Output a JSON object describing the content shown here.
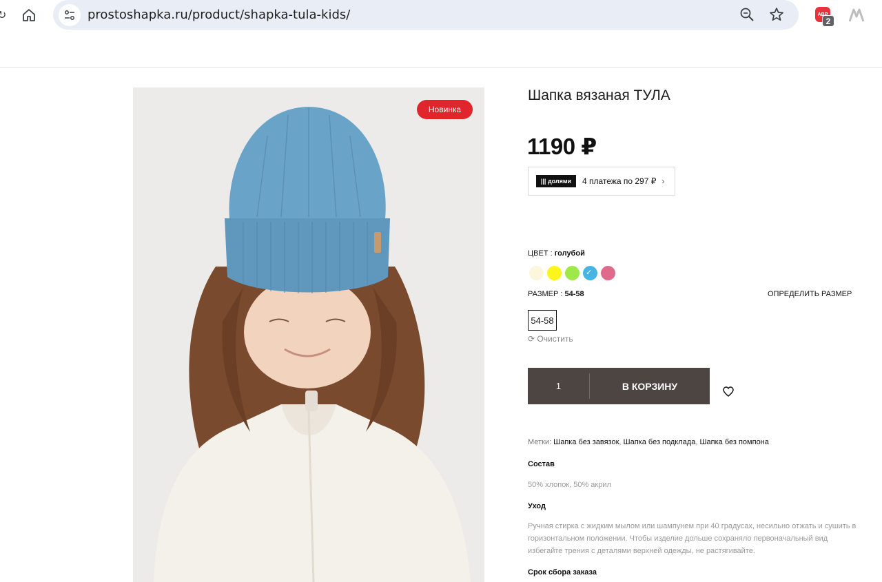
{
  "browser": {
    "url": "prostoshapka.ru/product/shapka-tula-kids/",
    "icons": {
      "home": "home-icon",
      "tune": "tune-icon",
      "zoom": "zoom-icon",
      "star": "star-icon",
      "adblock": "adblock-icon",
      "extension": "extension-logo-icon"
    },
    "adblock_label": "ABP",
    "adblock_count": "2"
  },
  "product": {
    "badge": "Новинка",
    "title": "Шапка вязаная ТУЛА",
    "price": "1190 ₽",
    "dolyami": {
      "logo": "||| долями",
      "text": "4 платежа по 297 ₽",
      "chevron": "›"
    },
    "color_label": "ЦВЕТ :",
    "color_value": "голубой",
    "colors": [
      "#fbf6dc",
      "#fbf51c",
      "#9ee84a",
      "#48b4e6",
      "#e06a8c"
    ],
    "selected_color_index": 3,
    "size_label": "РАЗМЕР :",
    "size_value": "54-58",
    "size_guide": "ОПРЕДЕЛИТЬ РАЗМЕР",
    "size_option": "54-58",
    "clear": "Очистить",
    "quantity": "1",
    "add_to_cart": "В КОРЗИНУ",
    "tags_label": "Метки:",
    "tags": [
      "Шапка без завязок",
      "Шапка без подклада",
      "Шапка без помпона"
    ],
    "composition_title": "Состав",
    "composition": "50% хлопок, 50% акрил",
    "care_title": "Уход",
    "care": "Ручная стирка с жидким мылом или шампунем при 40 градусах, несильно отжать и сушить в горизонтальном положении. Чтобы изделие дольше сохраняло первоначальный вид избегайте трения с деталями верхней одежды, не растягивайте.",
    "assembly_title": "Срок сбора заказа"
  },
  "colors": {
    "badge": "#e0262c",
    "cart_button": "#4d4542",
    "hat": "#6aa3c8",
    "hair": "#7a4a2e",
    "sweater": "#f4f0ea"
  }
}
